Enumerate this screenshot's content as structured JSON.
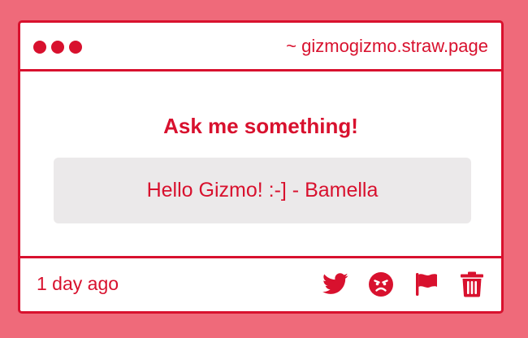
{
  "window": {
    "url": "~ gizmogizmo.straw.page"
  },
  "question": {
    "prompt": "Ask me something!",
    "message": "Hello Gizmo! :-] - Bamella"
  },
  "footer": {
    "timestamp": "1 day ago",
    "actions": [
      {
        "icon": "twitter-icon",
        "label": "Share on Twitter"
      },
      {
        "icon": "angry-face-icon",
        "label": "React"
      },
      {
        "icon": "flag-icon",
        "label": "Report"
      },
      {
        "icon": "trash-icon",
        "label": "Delete"
      }
    ]
  },
  "colors": {
    "accent": "#d8112e",
    "background": "#ef6a7a",
    "card": "#ffffff",
    "message_box": "#ebe9ea"
  }
}
